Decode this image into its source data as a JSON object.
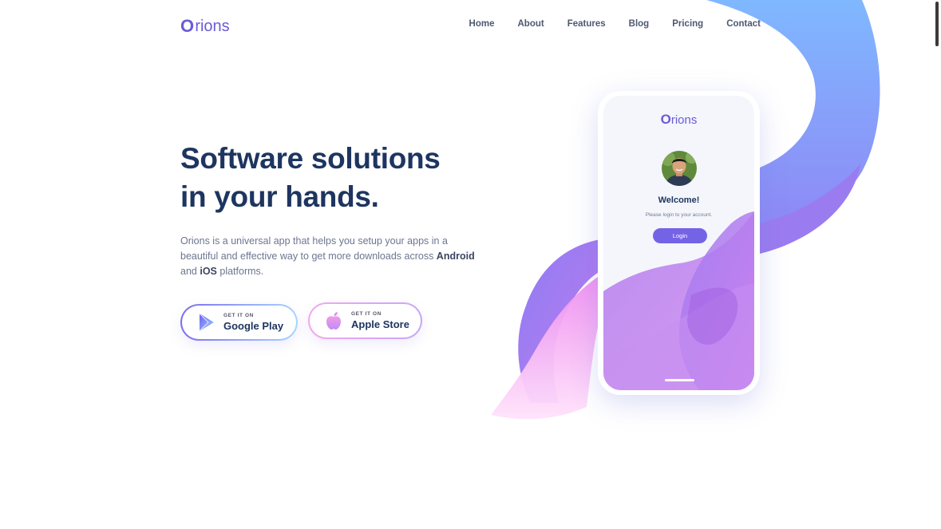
{
  "brand": {
    "logo_mark": "O",
    "logo_rest": "rions"
  },
  "nav": {
    "items": [
      {
        "label": "Home"
      },
      {
        "label": "About"
      },
      {
        "label": "Features"
      },
      {
        "label": "Blog"
      },
      {
        "label": "Pricing"
      },
      {
        "label": "Contact"
      }
    ]
  },
  "hero": {
    "title_line1": "Software solutions",
    "title_line2": "in your hands.",
    "desc_part1": "Orions is a universal app that helps you setup your apps in a beautiful and effective way to get more downloads across ",
    "desc_android": "Android",
    "desc_and": " and ",
    "desc_ios": "iOS",
    "desc_end": " platforms."
  },
  "store_buttons": {
    "google": {
      "small": "GET IT ON",
      "big": "Google Play",
      "icon": "google-play-icon"
    },
    "apple": {
      "small": "GET IT ON",
      "big": "Apple Store",
      "icon": "apple-icon"
    }
  },
  "phone": {
    "logo_mark": "O",
    "logo_rest": "rions",
    "welcome": "Welcome!",
    "subline": "Please login to your account.",
    "login_label": "Login"
  },
  "colors": {
    "accent": "#6a5cd6",
    "heading": "#1e3560",
    "body_text": "#6d7690",
    "ribbon_blue": "#6fa8ff",
    "ribbon_purple": "#a77bf2",
    "ribbon_pink": "#f28ee8"
  }
}
